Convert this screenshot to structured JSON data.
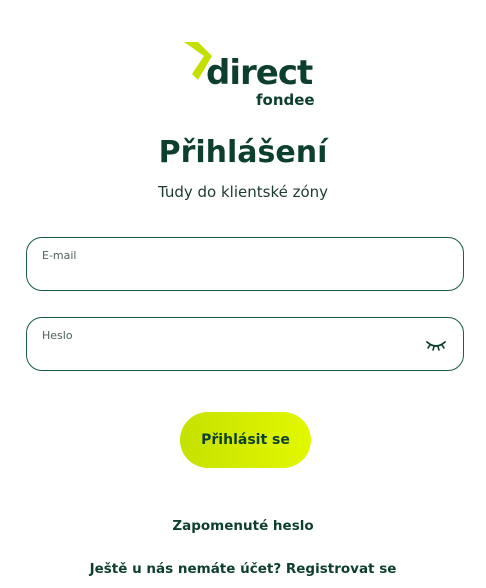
{
  "logo": {
    "word": "direct",
    "sub": "fondee",
    "mark_icon": "chevron-arrow-logo-icon",
    "mark_color": "#c4e000",
    "text_color": "#0d3f2f"
  },
  "page": {
    "title": "Přihlášení",
    "subtitle": "Tudy do klientské zóny"
  },
  "form": {
    "email": {
      "label": "E-mail",
      "value": ""
    },
    "password": {
      "label": "Heslo",
      "value": "",
      "toggle_icon": "eye-closed-icon"
    },
    "submit_label": "Přihlásit se"
  },
  "links": {
    "forgot": "Zapomenuté heslo",
    "register": "Ještě u nás nemáte účet? Registrovat se"
  },
  "colors": {
    "accent": "#d4ee00",
    "brand_dark": "#0d3f2f",
    "field_border": "#1b5a48"
  }
}
